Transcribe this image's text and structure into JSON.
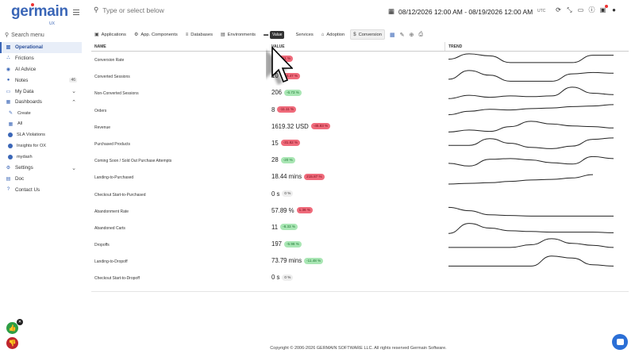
{
  "app": {
    "logo": "germain",
    "logo_sub": "UX"
  },
  "sidebar": {
    "search_placeholder": "Search menu",
    "items": [
      {
        "label": "Operational",
        "icon": "bar-chart-icon",
        "active": true
      },
      {
        "label": "Frictions",
        "icon": "friction-icon"
      },
      {
        "label": "AI Advice",
        "icon": "ai-advice-icon"
      },
      {
        "label": "Notes",
        "icon": "notes-icon",
        "badge": "46"
      },
      {
        "label": "My Data",
        "icon": "my-data-icon",
        "chevron": "⌄"
      },
      {
        "label": "Dashboards",
        "icon": "dashboard-icon",
        "chevron": "⌃"
      }
    ],
    "dashboard_sub": [
      {
        "label": "Create",
        "icon": "pencil-icon"
      },
      {
        "label": "All",
        "icon": "grid-icon"
      },
      {
        "label": "SLA Violations",
        "icon": "sla-icon"
      },
      {
        "label": "Insights for OX",
        "icon": "insights-icon"
      },
      {
        "label": "mydash",
        "icon": "mydash-icon"
      }
    ],
    "bottom_items": [
      {
        "label": "Settings",
        "icon": "gear-icon",
        "chevron": "⌄"
      },
      {
        "label": "Doc",
        "icon": "doc-icon"
      },
      {
        "label": "Contact Us",
        "icon": "help-icon"
      }
    ]
  },
  "topbar": {
    "search_placeholder": "Type or select below",
    "date_range": "08/12/2026 12:00 AM - 08/19/2026 12:00 AM",
    "timezone": "UTC"
  },
  "tabs": [
    {
      "label": "Applications",
      "icon": "▣"
    },
    {
      "label": "App. Components",
      "icon": "⚙"
    },
    {
      "label": "Databases",
      "icon": "≡"
    },
    {
      "label": "Environments",
      "icon": "▤"
    },
    {
      "label": "Ho",
      "icon": "▬"
    },
    {
      "label": "Services",
      "icon": ""
    },
    {
      "label": "Adoption",
      "icon": "⌂"
    },
    {
      "label": "Conversion",
      "icon": "$",
      "active": true
    }
  ],
  "tooltip": "Value",
  "table": {
    "headers": {
      "name": "NAME",
      "value": "VALUE",
      "trend": "TREND"
    },
    "rows": [
      {
        "name": "Conversion Rate",
        "value": "",
        "change": "-15.11 %",
        "pill": "red"
      },
      {
        "name": "Converted Sessions",
        "value": "10",
        "change": "-44.47 %",
        "pill": "red"
      },
      {
        "name": "Non-Converted Sessions",
        "value": "206",
        "change": "-6.73 %",
        "pill": "green"
      },
      {
        "name": "Orders",
        "value": "8",
        "change": "-11.11 %",
        "pill": "red"
      },
      {
        "name": "Revenue",
        "value": "1619.32 USD",
        "change": "-45.83 %",
        "pill": "red"
      },
      {
        "name": "Purchased Products",
        "value": "15",
        "change": "-31.82 %",
        "pill": "red"
      },
      {
        "name": "Coming Soon / Sold Out Purchase Attempts",
        "value": "28",
        "change": "-20 %",
        "pill": "green"
      },
      {
        "name": "Landing-to-Purchased",
        "value": "18.44 mins",
        "change": "215.87 %",
        "pill": "red"
      },
      {
        "name": "Checkout Start-to-Purchased",
        "value": "0 s",
        "change": "0 %",
        "pill": "gray"
      },
      {
        "name": "Abandonment Rate",
        "value": "57.89 %",
        "change": "1.36 %",
        "pill": "red"
      },
      {
        "name": "Abandoned Carts",
        "value": "11",
        "change": "-8.33 %",
        "pill": "green"
      },
      {
        "name": "Dropoffs",
        "value": "197",
        "change": "-5.96 %",
        "pill": "green"
      },
      {
        "name": "Landing-to-Dropoff",
        "value": "73.79 mins",
        "change": "-11.48 %",
        "pill": "green"
      },
      {
        "name": "Checkout Start-to-Dropoff",
        "value": "0 s",
        "change": "0 %",
        "pill": "gray"
      }
    ]
  },
  "trend_series": [
    [
      0.55,
      0.95,
      0.8,
      0.3,
      0.3,
      0.3,
      0.3,
      0.85,
      0.85
    ],
    [
      0.3,
      0.95,
      0.6,
      0.15,
      0.15,
      0.15,
      0.7,
      0.8,
      0.75
    ],
    [
      0.1,
      0.35,
      0.2,
      0.3,
      0.25,
      0.3,
      0.95,
      0.5,
      0.4
    ],
    [
      0.2,
      0.45,
      0.6,
      0.55,
      0.65,
      0.7,
      0.8,
      0.85,
      0.95
    ],
    [
      0.15,
      0.3,
      0.2,
      0.55,
      0.95,
      0.75,
      0.6,
      0.55,
      0.45
    ],
    [
      0.4,
      0.4,
      0.9,
      0.55,
      0.25,
      0.15,
      0.35,
      0.85,
      0.95
    ],
    [
      0.3,
      0.1,
      0.6,
      0.65,
      0.55,
      0.35,
      0.25,
      0.8,
      0.65
    ],
    [
      0.0,
      0.05,
      0.1,
      0.2,
      0.3,
      0.35,
      0.45,
      0.7,
      null
    ],
    [],
    [
      0.8,
      0.55,
      0.25,
      0.2,
      0.15,
      0.15,
      0.15,
      0.15,
      0.15
    ],
    [
      0.1,
      0.85,
      0.5,
      0.3,
      0.25,
      0.2,
      0.2,
      0.2,
      0.15
    ],
    [
      0.3,
      0.3,
      0.3,
      0.3,
      0.5,
      0.95,
      0.6,
      0.45,
      0.3
    ],
    [
      0.15,
      0.15,
      0.15,
      0.15,
      0.15,
      0.9,
      0.75,
      0.25,
      0.15
    ],
    []
  ],
  "footer": "Copyright © 2006-2026 GERMAIN SOFTWARE LLC. All rights reserved Germain Software."
}
